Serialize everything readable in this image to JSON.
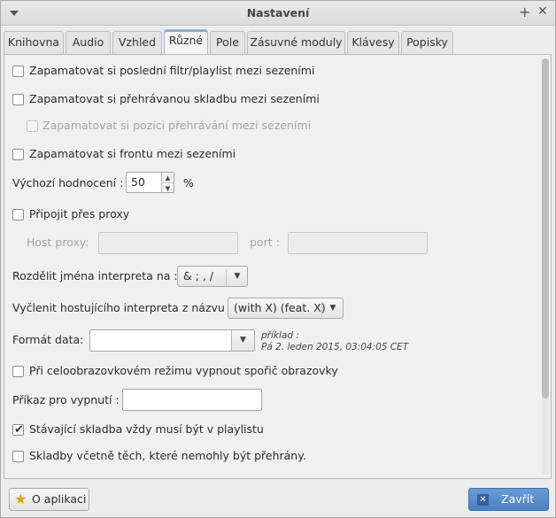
{
  "window": {
    "title": "Nastavení"
  },
  "tabs": [
    {
      "label": "Knihovna"
    },
    {
      "label": "Audio"
    },
    {
      "label": "Vzhled"
    },
    {
      "label": "Různé"
    },
    {
      "label": "Pole"
    },
    {
      "label": "Zásuvné moduly"
    },
    {
      "label": "Klávesy"
    },
    {
      "label": "Popisky"
    }
  ],
  "active_tab": "Různé",
  "options": {
    "remember_filter": {
      "label": "Zapamatovat si poslední filtr/playlist mezi sezeními",
      "checked": false
    },
    "remember_track": {
      "label": "Zapamatovat si přehrávanou skladbu mezi sezeními",
      "checked": false
    },
    "remember_position": {
      "label": "Zapamatovat si pozici přehrávání mezi sezeními",
      "checked": false,
      "disabled": true
    },
    "remember_queue": {
      "label": "Zapamatovat si frontu mezi sezeními",
      "checked": false
    },
    "default_rating": {
      "label": "Výchozí hodnocení :",
      "value": "50",
      "unit": "%"
    },
    "proxy": {
      "label": "Připojit přes proxy",
      "checked": false,
      "host_label": "Host proxy:",
      "host_value": "",
      "port_label": "port :",
      "port_value": ""
    },
    "split_artists": {
      "label": "Rozdělit jména interpreta na :",
      "value": "& ;  ,   /"
    },
    "extract_guest": {
      "label": "Vyčlenit hostujícího interpreta z názvu :",
      "value": "(with X)  (feat. X)"
    },
    "date_format": {
      "label": "Formát data:",
      "value": "",
      "example_label": "příklad :",
      "example_value": "Pá 2. leden 2015, 03:04:05 CET"
    },
    "screensaver": {
      "label": "Při celoobrazovkovém režimu vypnout spořič obrazovky",
      "checked": false
    },
    "shutdown": {
      "label": "Příkaz pro vypnutí :",
      "value": ""
    },
    "current_in_playlist": {
      "label": "Stávající skladba vždy musí být v playlistu",
      "checked": true
    },
    "include_unplayable": {
      "label": "Skladby včetně těch, které nemohly být přehrány.",
      "checked": false
    }
  },
  "buttons": {
    "about": "O aplikaci",
    "close": "Zavřít"
  },
  "icons": {
    "window_menu": "chevron-down-icon",
    "maximize": "plus-icon",
    "close": "close-icon",
    "about": "star-icon",
    "close_button": "close-box-icon"
  },
  "colors": {
    "accent": "#4a7fc1",
    "active_tab_highlight": "#86a6cf",
    "about_star": "#d9a400"
  }
}
